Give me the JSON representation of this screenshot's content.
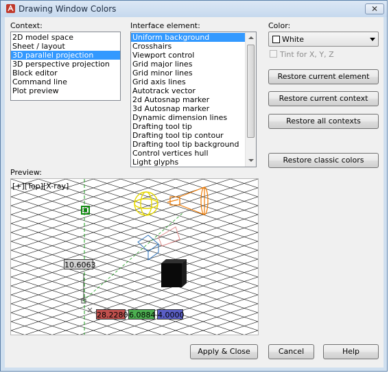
{
  "window": {
    "title": "Drawing Window Colors",
    "close_glyph": "✕"
  },
  "context": {
    "label": "Context:",
    "items": [
      "2D model space",
      "Sheet / layout",
      "3D parallel projection",
      "3D perspective projection",
      "Block editor",
      "Command line",
      "Plot preview"
    ],
    "selected_index": 2
  },
  "interface": {
    "label": "Interface element:",
    "items": [
      "Uniform background",
      "Crosshairs",
      "Viewport control",
      "Grid major lines",
      "Grid minor lines",
      "Grid axis lines",
      "Autotrack vector",
      "2d Autosnap marker",
      "3d Autosnap marker",
      "Dynamic dimension lines",
      "Drafting tool tip",
      "Drafting tool tip contour",
      "Drafting tool tip background",
      "Control vertices hull",
      "Light glyphs"
    ],
    "selected_index": 0
  },
  "color": {
    "label": "Color:",
    "value": "White",
    "swatch": "#ffffff",
    "tint_label": "Tint for X, Y, Z",
    "tint_checked": false,
    "tint_enabled": false
  },
  "buttons": {
    "restore_current_element": "Restore current element",
    "restore_current_context": "Restore current context",
    "restore_all_contexts": "Restore all contexts",
    "restore_classic_colors": "Restore classic colors",
    "apply_close": "Apply & Close",
    "cancel": "Cancel",
    "help": "Help"
  },
  "preview": {
    "label": "Preview:",
    "viewport_label": "[+][Top][X-ray]",
    "dim_value": "10.6063",
    "coord_x": "28.2280",
    "coord_y": "6.0884",
    "coord_z": "4.0000",
    "coord_x_color": "#c0504d",
    "coord_y_color": "#4caf50",
    "coord_z_color": "#5b5fc7"
  }
}
